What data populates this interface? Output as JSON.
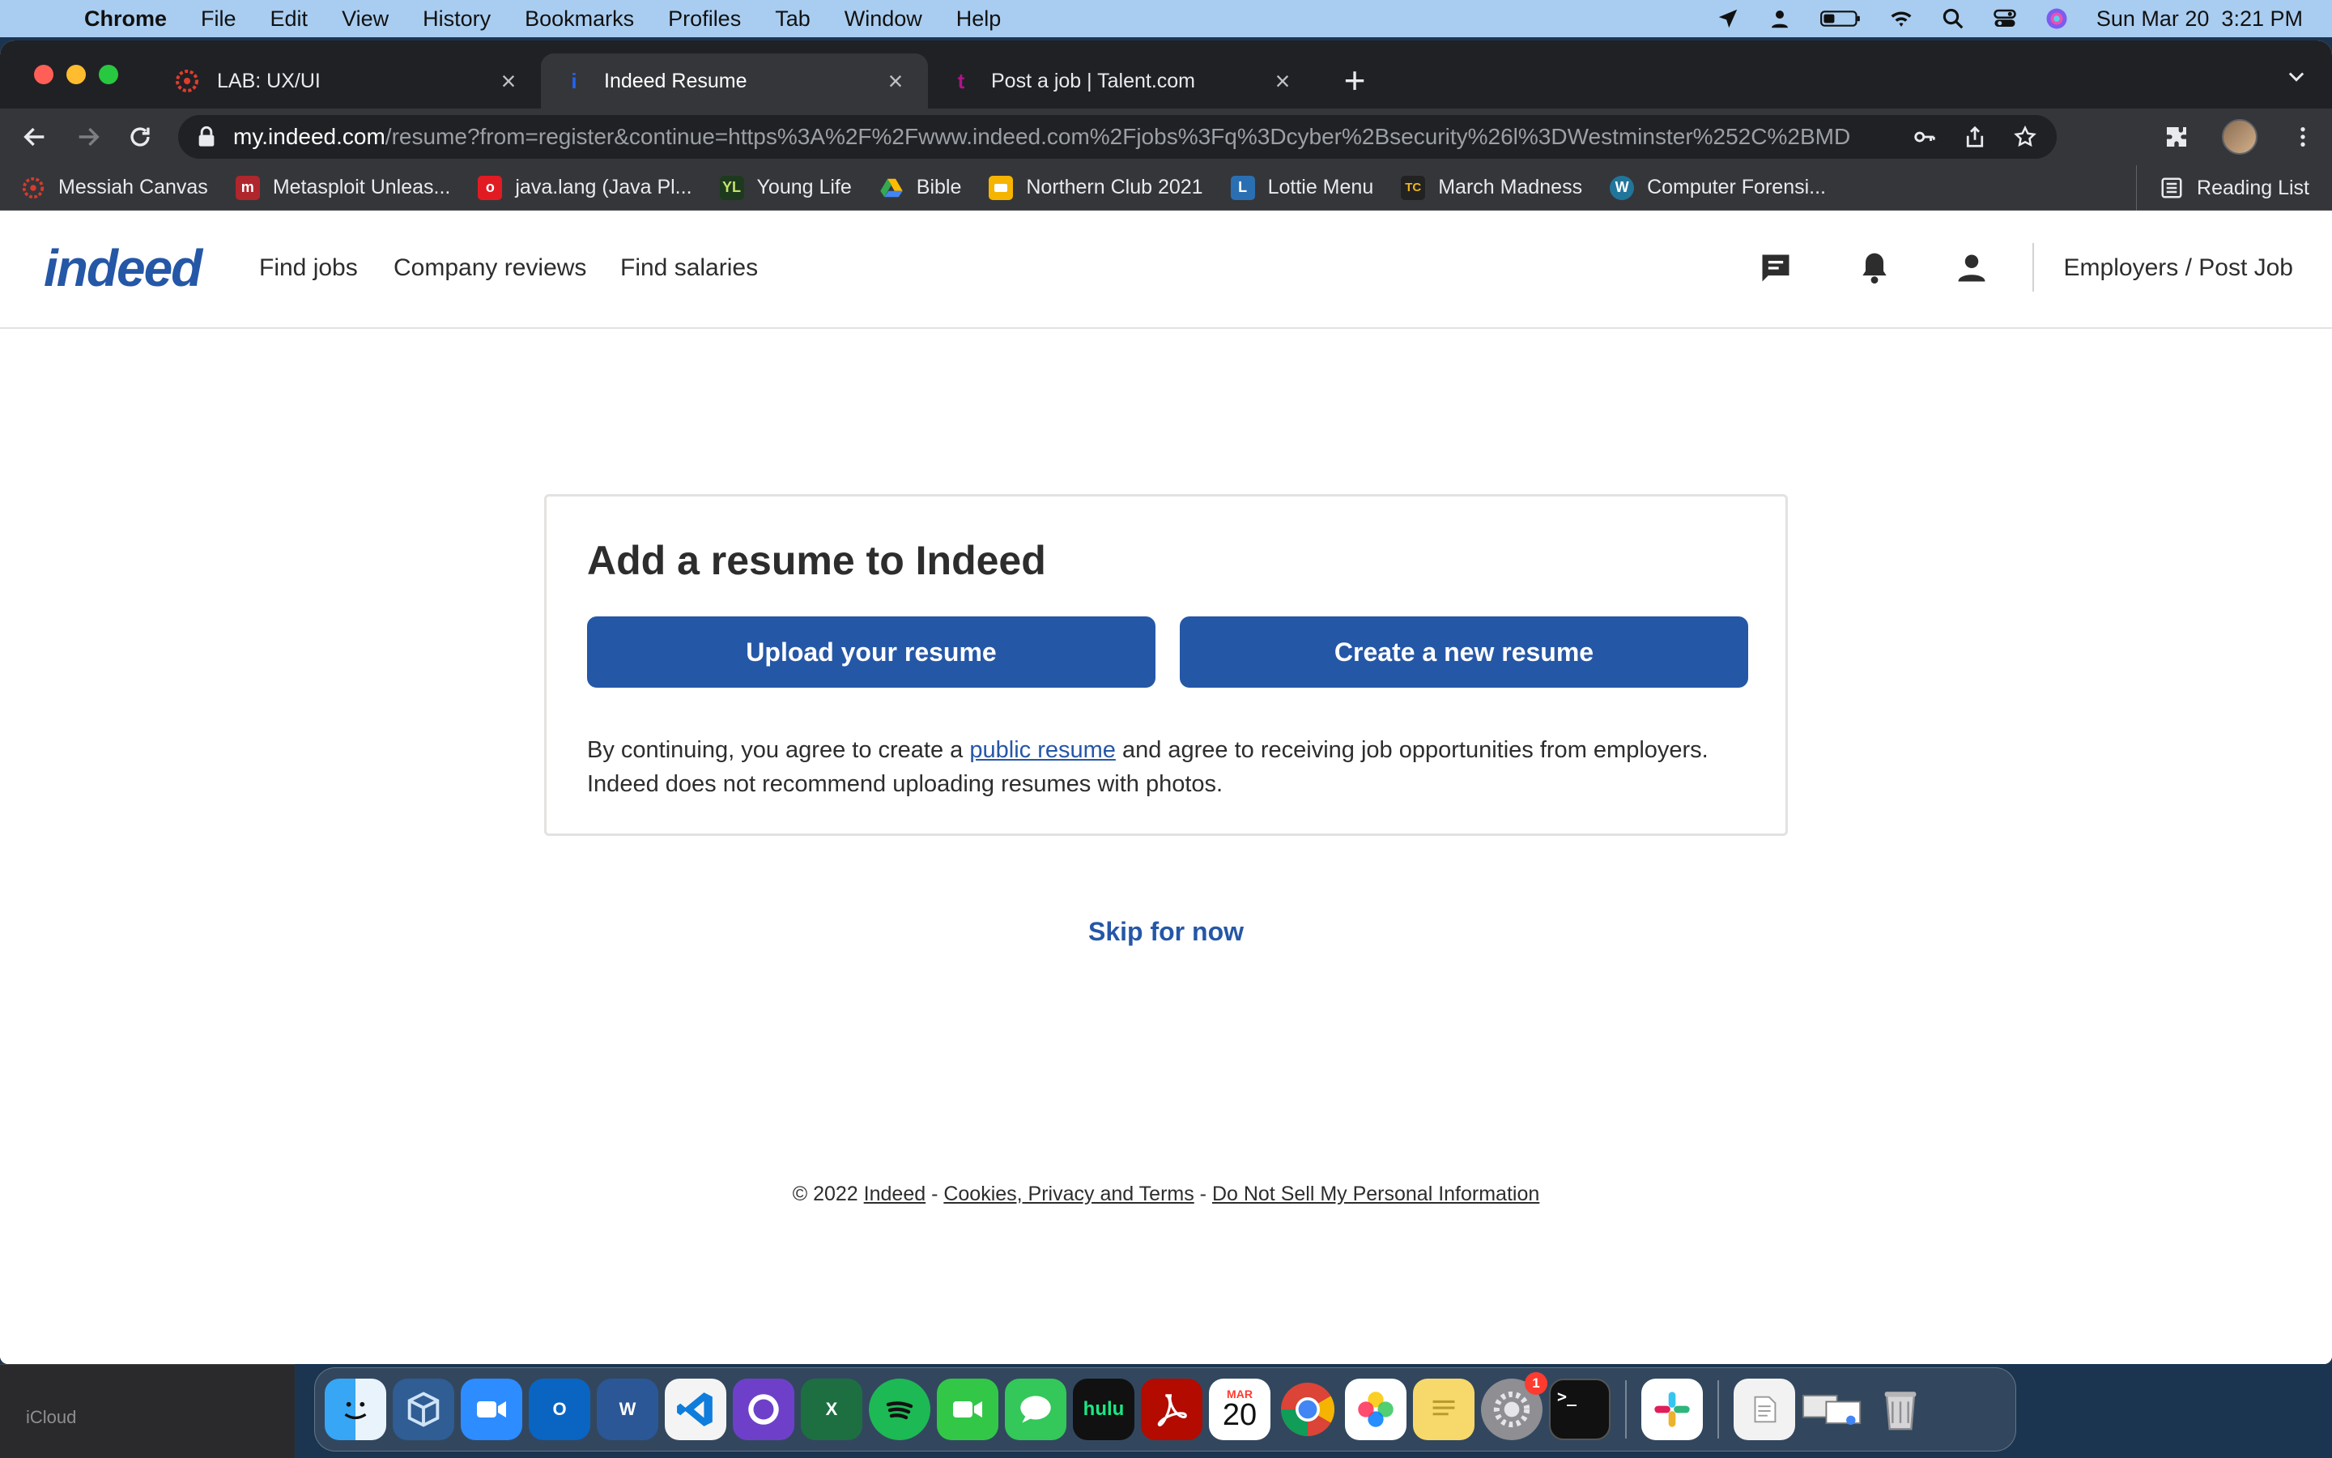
{
  "menubar": {
    "app_name": "Chrome",
    "menus": [
      "File",
      "Edit",
      "View",
      "History",
      "Bookmarks",
      "Profiles",
      "Tab",
      "Window",
      "Help"
    ],
    "datetime": "Sun Mar 20  3:21 PM"
  },
  "tabs": [
    {
      "title": "LAB: UX/UI",
      "favicon": "canvas-icon",
      "active": false
    },
    {
      "title": "Indeed Resume",
      "favicon": "indeed-icon",
      "active": true
    },
    {
      "title": "Post a job | Talent.com",
      "favicon": "talent-icon",
      "active": false
    }
  ],
  "address_bar": {
    "host": "my.indeed.com",
    "path": "/resume?from=register&continue=https%3A%2F%2Fwww.indeed.com%2Fjobs%3Fq%3Dcyber%2Bsecurity%26l%3DWestminster%252C%2BMD"
  },
  "bookmarks": [
    {
      "label": "Messiah Canvas",
      "color": "#d63b2f"
    },
    {
      "label": "Metasploit Unleas...",
      "color": "#b0262d"
    },
    {
      "label": "java.lang (Java Pl...",
      "color": "#e21b23"
    },
    {
      "label": "Young Life",
      "color": "#2d7a2d"
    },
    {
      "label": "Bible",
      "color": "#34a853"
    },
    {
      "label": "Northern Club 2021",
      "color": "#f4b400"
    },
    {
      "label": "Lottie Menu",
      "color": "#2b6fb3"
    },
    {
      "label": "March Madness",
      "color": "#222222"
    },
    {
      "label": "Computer Forensi...",
      "color": "#21759b"
    }
  ],
  "reading_list_label": "Reading List",
  "site": {
    "logo_text": "indeed",
    "nav": [
      "Find jobs",
      "Company reviews",
      "Find salaries"
    ],
    "employers_link": "Employers / Post Job",
    "brand_color": "#2557a7"
  },
  "card": {
    "title": "Add a resume to Indeed",
    "upload_button": "Upload your resume",
    "create_button": "Create a new resume",
    "text_before_link": "By continuing, you agree to create a ",
    "link_text": "public resume",
    "text_after_link": " and agree to receiving job opportunities from employers.",
    "text_line2": "Indeed does not recommend uploading resumes with photos."
  },
  "skip_label": "Skip for now",
  "footer": {
    "copyright": "© 2022 ",
    "indeed_link": "Indeed",
    "sep1": " - ",
    "cookies_link": "Cookies, Privacy and Terms",
    "sep2": " - ",
    "donotsell_link": "Do Not Sell My Personal Information"
  },
  "desktop": {
    "sidebar_label": "iCloud",
    "dock_apps": [
      "finder",
      "virtualbox",
      "zoom",
      "outlook",
      "word",
      "vscode",
      "github-desktop",
      "excel",
      "spotify",
      "facetime",
      "messages",
      "hulu",
      "acrobat",
      "calendar",
      "chrome",
      "photos",
      "stickies",
      "system-preferences",
      "terminal",
      "slack",
      "documents",
      "downloads",
      "trash"
    ],
    "hulu_label": "hulu",
    "calendar_month": "MAR",
    "calendar_day": "20",
    "system_prefs_badge": "1",
    "terminal_prompt": ">_"
  }
}
